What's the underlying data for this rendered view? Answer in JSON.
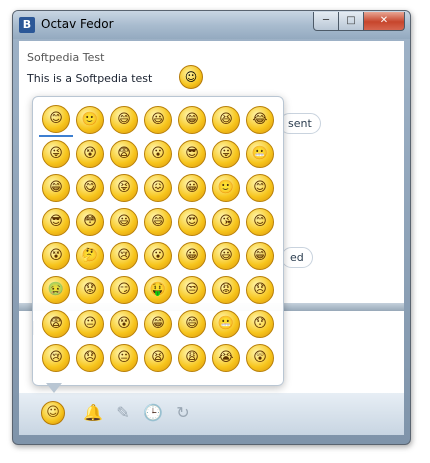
{
  "window": {
    "title": "Octav Fedor",
    "app_icon": "B",
    "minimize": "─",
    "maximize": "□",
    "close": "✕"
  },
  "conversation": {
    "sender": "Softpedia Test",
    "message": "This is a Softpedia test",
    "message_emoji": "☺",
    "status_1": "sent",
    "status_2": "ed"
  },
  "emoji_picker": {
    "emojis": [
      "😊",
      "🙂",
      "😄",
      "😃",
      "😁",
      "😆",
      "😂",
      "😜",
      "😵",
      "😨",
      "😮",
      "😎",
      "😛",
      "😬",
      "😁",
      "😋",
      "😝",
      "😖",
      "😀",
      "🙂",
      "😊",
      "😎",
      "😳",
      "😃",
      "😄",
      "😍",
      "😘",
      "😊",
      "😵",
      "🤔",
      "😢",
      "😮",
      "😀",
      "😃",
      "😁",
      "🤢",
      "😟",
      "😏",
      "🤑",
      "😒",
      "😡",
      "😞",
      "😨",
      "😐",
      "😵",
      "😁",
      "😄",
      "😬",
      "😯",
      "😢",
      "😞",
      "😐",
      "😫",
      "😩",
      "😭",
      "😲"
    ]
  },
  "toolbar": {
    "emoji_icon": "☺",
    "bell_icon": "🔔",
    "pencil_icon": "✎",
    "clock_icon": "🕒",
    "nudge_icon": "↻"
  }
}
